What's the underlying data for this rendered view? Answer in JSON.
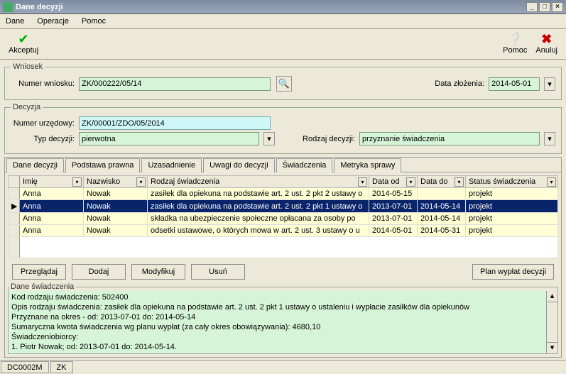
{
  "window": {
    "title": "Dane decyzji"
  },
  "menu": {
    "dane": "Dane",
    "operacje": "Operacje",
    "pomoc": "Pomoc"
  },
  "toolbar": {
    "akceptuj": "Akceptuj",
    "pomoc": "Pomoc",
    "anuluj": "Anuluj"
  },
  "wniosek": {
    "legend": "Wniosek",
    "numer_wniosku_label": "Numer wniosku:",
    "numer_wniosku_value": "ZK/000222/05/14",
    "data_zlozenia_label": "Data złożenia:",
    "data_zlozenia_value": "2014-05-01"
  },
  "decyzja": {
    "legend": "Decyzja",
    "numer_urzedowy_label": "Numer urzędowy:",
    "numer_urzedowy_value": "ZK/00001/ZDO/05/2014",
    "typ_decyzji_label": "Typ decyzji:",
    "typ_decyzji_value": "pierwotna",
    "rodzaj_decyzji_label": "Rodzaj decyzji:",
    "rodzaj_decyzji_value": "przyznanie świadczenia"
  },
  "tabs": {
    "t0": "Dane decyzji",
    "t1": "Podstawa prawna",
    "t2": "Uzasadnienie",
    "t3": "Uwagi do decyzji",
    "t4": "Świadczenia",
    "t5": "Metryka sprawy"
  },
  "grid": {
    "headers": {
      "imie": "Imię",
      "nazwisko": "Nazwisko",
      "rodzaj": "Rodzaj świadczenia",
      "data_od": "Data od",
      "data_do": "Data do",
      "status": "Status świadczenia"
    },
    "rows": [
      {
        "imie": "Anna",
        "nazwisko": "Nowak",
        "rodzaj": "zasiłek dla opiekuna na podstawie art. 2 ust. 2 pkt 2 ustawy o",
        "data_od": "2014-05-15",
        "data_do": "",
        "status": "projekt"
      },
      {
        "imie": "Anna",
        "nazwisko": "Nowak",
        "rodzaj": "zasiłek dla opiekuna na podstawie art. 2 ust. 2 pkt 1 ustawy o",
        "data_od": "2013-07-01",
        "data_do": "2014-05-14",
        "status": "projekt"
      },
      {
        "imie": "Anna",
        "nazwisko": "Nowak",
        "rodzaj": "składka na ubezpieczenie społeczne opłacana za osoby po",
        "data_od": "2013-07-01",
        "data_do": "2014-05-14",
        "status": "projekt"
      },
      {
        "imie": "Anna",
        "nazwisko": "Nowak",
        "rodzaj": "odsetki ustawowe, o których mowa w art. 2 ust. 3 ustawy o u",
        "data_od": "2014-05-01",
        "data_do": "2014-05-31",
        "status": "projekt"
      }
    ]
  },
  "buttons": {
    "przegladaj": "Przeglądaj",
    "dodaj": "Dodaj",
    "modyfikuj": "Modyfikuj",
    "usun": "Usuń",
    "plan_wyplat": "Plan wypłat decyzji"
  },
  "details": {
    "legend": "Dane świadczenia",
    "line1": "Kod rodzaju świadczenia: 502400",
    "line2": "Opis rodzaju świadczenia: zasiłek dla opiekuna na podstawie art. 2 ust. 2 pkt 1 ustawy o ustaleniu i wypłacie zasiłków dla opiekunów",
    "line3": "Przyznane na okres - od: 2013-07-01 do: 2014-05-14",
    "line4": "Sumaryczna kwota świadczenia wg planu wypłat (za cały okres obowiązywania): 4680,10",
    "line5": "Świadczeniobiorcy:",
    "line6": "1. Piotr Nowak; od: 2013-07-01 do: 2014-05-14."
  },
  "status": {
    "cell1": "DC0002M",
    "cell2": "ZK"
  }
}
